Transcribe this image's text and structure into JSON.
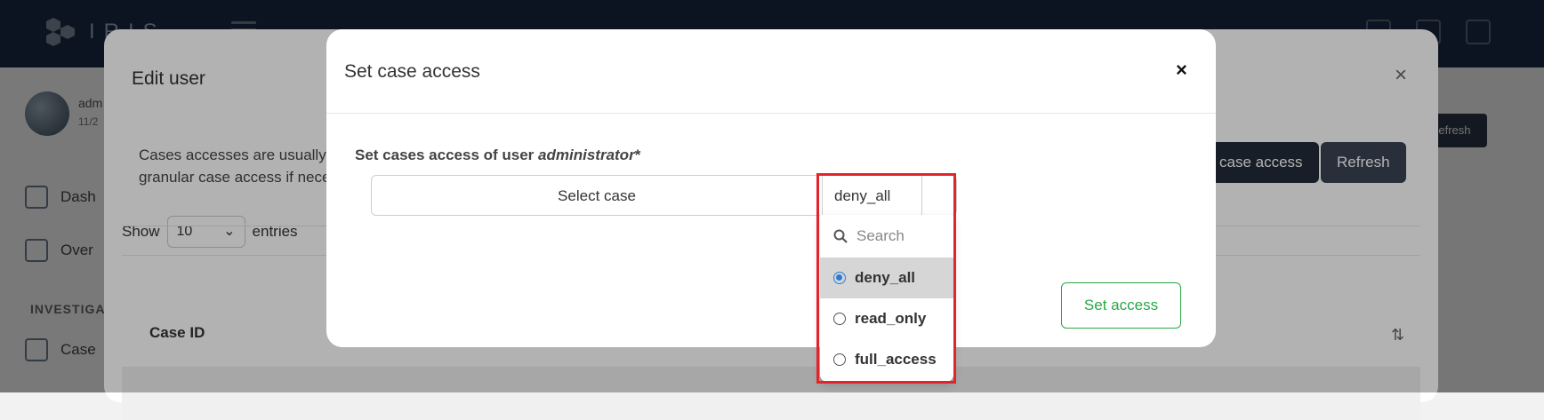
{
  "navbar": {
    "brand": "IRIS",
    "title": ""
  },
  "sidebar": {
    "user_name": "adm",
    "user_sub": "11/2",
    "items": [
      {
        "label": "Dash",
        "icon": "home-icon"
      },
      {
        "label": "Over",
        "icon": "overview-icon"
      }
    ],
    "section": "INVESTIGA",
    "cases_item": {
      "label": "Case",
      "icon": "cases-icon"
    }
  },
  "background_buttons": {
    "right_top": "Refresh"
  },
  "edit_user_modal": {
    "title": "Edit user",
    "close_label": "×",
    "description_line1": "Cases accesses are usually i",
    "description_line2": "granular case access if neces",
    "show_label": "Show",
    "entries_select": "10",
    "entries_label": "entries",
    "grant_button": "case access",
    "refresh_button": "Refresh",
    "table": {
      "column_case_id": "Case ID"
    }
  },
  "case_access_modal": {
    "title": "Set case access",
    "close_label": "×",
    "label_prefix": "Set cases access of user",
    "label_user": "administrator",
    "label_required": "*",
    "select_case_placeholder": "Select case",
    "access_value": "deny_all",
    "set_access_button": "Set access",
    "dropdown": {
      "search_placeholder": "Search",
      "options": [
        {
          "label": "deny_all",
          "selected": true
        },
        {
          "label": "read_only",
          "selected": false
        },
        {
          "label": "full_access",
          "selected": false
        }
      ]
    }
  },
  "colors": {
    "accent_green": "#28a745",
    "radio_blue": "#2b7cd3",
    "highlight_red": "#e3242b",
    "navbar": "#1a2c45"
  }
}
